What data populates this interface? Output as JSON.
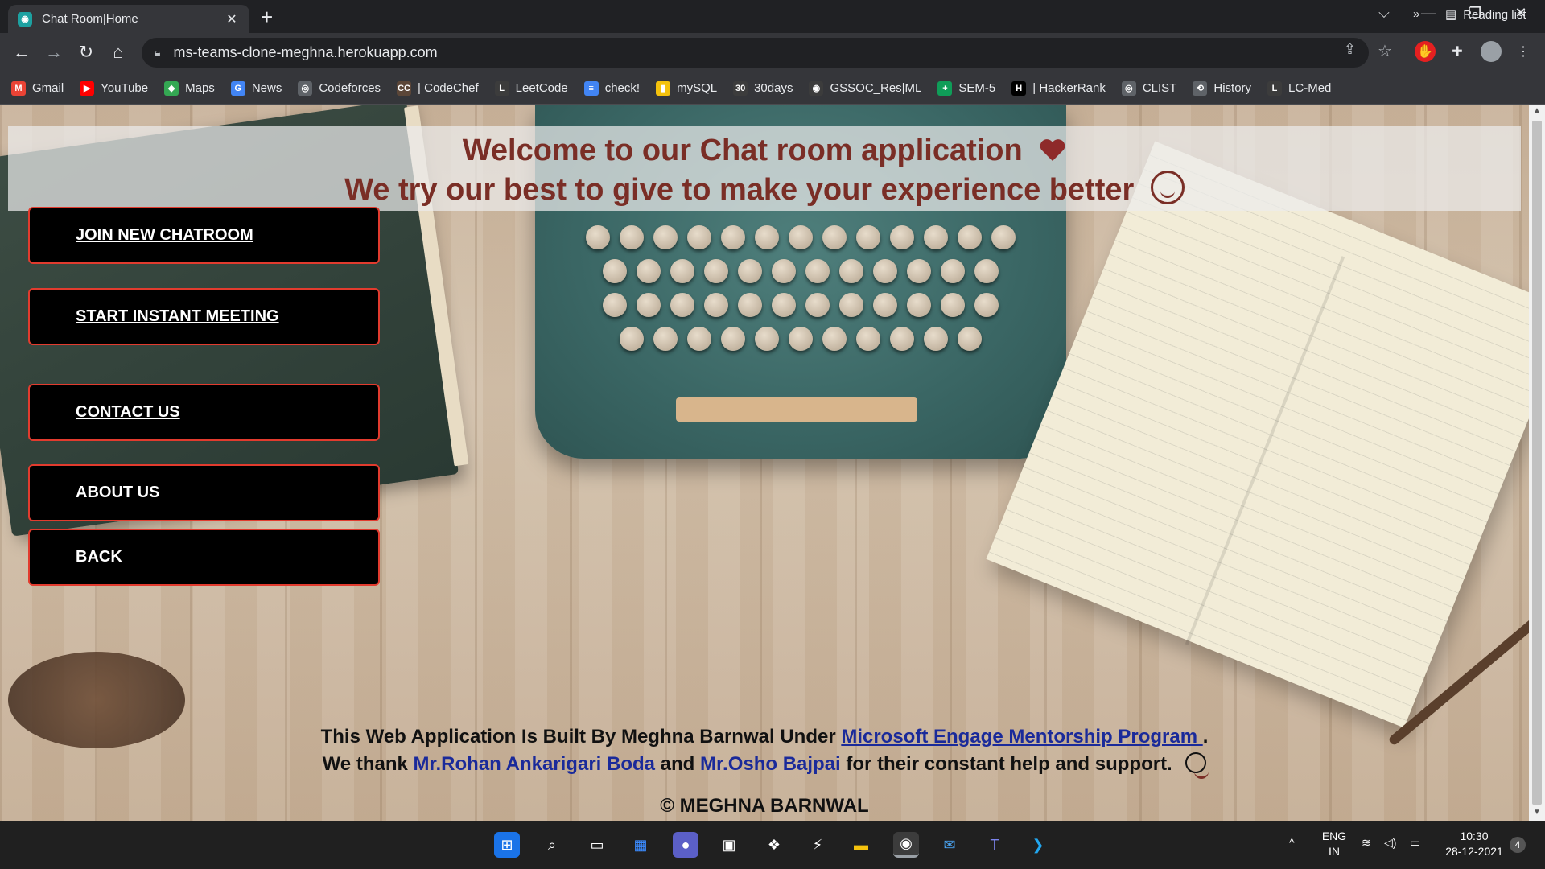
{
  "browser": {
    "tab_title": "Chat Room|Home",
    "tab_close": "✕",
    "new_tab": "+",
    "url": "ms-teams-clone-meghna.herokuapp.com",
    "window_controls": {
      "dropdown": "⌵",
      "minimize": "—",
      "restore": "❐",
      "close": "✕"
    },
    "nav": {
      "back": "←",
      "forward": "→",
      "reload": "↻",
      "home": "⌂"
    },
    "bookmarks": [
      {
        "label": "Gmail",
        "color": "#ea4335",
        "glyph": "M"
      },
      {
        "label": "YouTube",
        "color": "#ff0000",
        "glyph": "▶"
      },
      {
        "label": "Maps",
        "color": "#34a853",
        "glyph": "◆"
      },
      {
        "label": "News",
        "color": "#4285f4",
        "glyph": "G"
      },
      {
        "label": "Codeforces",
        "color": "#5f6368",
        "glyph": "◎"
      },
      {
        "label": "| CodeChef",
        "color": "#5b4638",
        "glyph": "CC"
      },
      {
        "label": "LeetCode",
        "color": "#3c3c3c",
        "glyph": "L"
      },
      {
        "label": "check!",
        "color": "#4285f4",
        "glyph": "≡"
      },
      {
        "label": "mySQL",
        "color": "#f4c20d",
        "glyph": "▮"
      },
      {
        "label": "30days",
        "color": "#3c3c3c",
        "glyph": "30"
      },
      {
        "label": "GSSOC_Res|ML",
        "color": "#3c3c3c",
        "glyph": "◉"
      },
      {
        "label": "SEM-5",
        "color": "#0f9d58",
        "glyph": "+"
      },
      {
        "label": "| HackerRank",
        "color": "#000000",
        "glyph": "H"
      },
      {
        "label": "CLIST",
        "color": "#5f6368",
        "glyph": "◎"
      },
      {
        "label": "History",
        "color": "#5f6368",
        "glyph": "⟲"
      },
      {
        "label": "LC-Med",
        "color": "#3c3c3c",
        "glyph": "L"
      }
    ],
    "more_bookmarks": "»",
    "reading_list": "Reading list"
  },
  "page": {
    "banner": {
      "line1": "Welcome to our Chat room application",
      "line2": "We try our best to give to make your experience better"
    },
    "menu": [
      {
        "label": "JOIN NEW CHATROOM",
        "underlined": true
      },
      {
        "label": "START INSTANT MEETING",
        "underlined": true
      },
      {
        "label": "CONTACT US",
        "underlined": true
      },
      {
        "label": "ABOUT US",
        "underlined": false
      },
      {
        "label": "BACK",
        "underlined": false
      }
    ],
    "credits": {
      "line1_prefix": "This Web Application Is Built By Meghna Barnwal Under ",
      "program_link": "Microsoft Engage Mentorship Program ",
      "line1_suffix": ".",
      "line2_prefix": "We thank ",
      "mentor1": "Mr.Rohan Ankarigari Boda",
      "and": " and ",
      "mentor2": "Mr.Osho Bajpai",
      "line2_suffix": " for their constant help and support."
    },
    "copyright": "© MEGHNA BARNWAL"
  },
  "taskbar": {
    "language": "ENG",
    "region": "IN",
    "time": "10:30",
    "date": "28-12-2021",
    "notifications": "4",
    "tray_chevron": "^"
  },
  "colors": {
    "banner_text": "#7a2e26",
    "button_bg": "#000000",
    "button_border": "#e23b2e",
    "link": "#1a2a9a"
  }
}
